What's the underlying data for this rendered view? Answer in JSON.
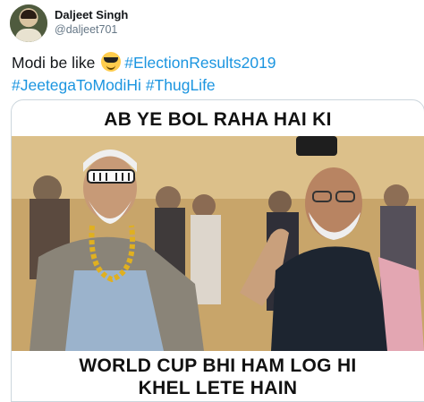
{
  "tweet": {
    "author_name": "Daljeet Singh",
    "author_handle": "@daljeet701",
    "text_intro": "Modi be like",
    "emoji": "smiling-face-with-sunglasses",
    "hashtags": [
      "#ElectionResults2019",
      "#JeetegaToModiHi",
      "#ThugLife"
    ]
  },
  "meme": {
    "top_caption": "AB YE BOL RAHA HAI KI",
    "bottom_caption_line1": "WORLD CUP BHI HAM LOG HI",
    "bottom_caption_line2": "KHEL LETE HAIN"
  },
  "colors": {
    "hashtag": "#1b95e0",
    "name": "#14171a",
    "handle": "#657786"
  }
}
